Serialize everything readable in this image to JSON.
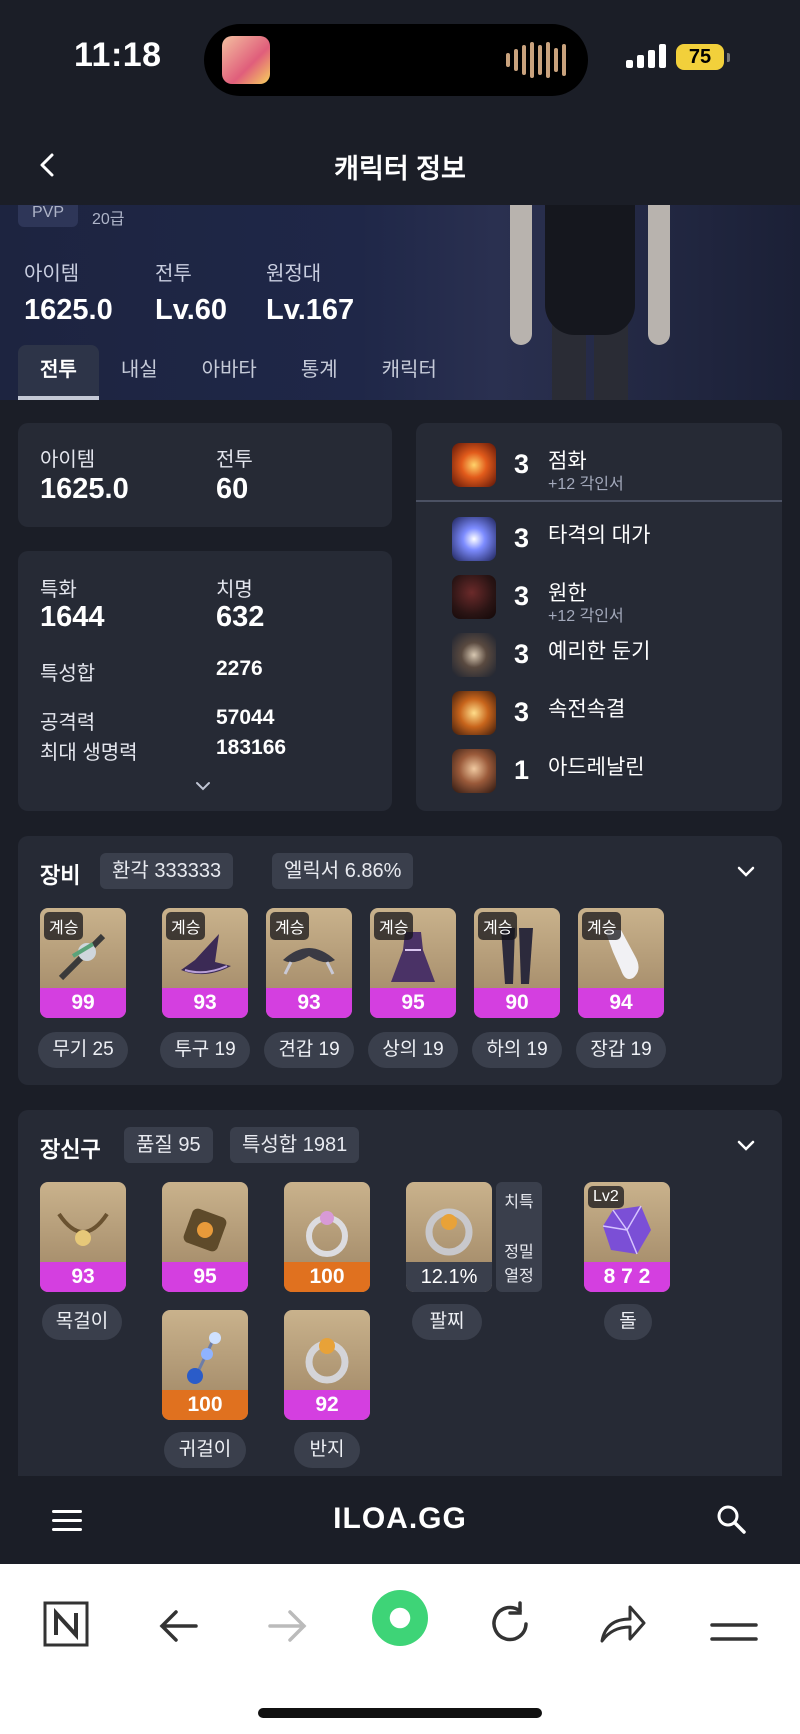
{
  "status": {
    "time": "11:18",
    "battery": "75"
  },
  "header": {
    "title": "캐릭터 정보"
  },
  "hero": {
    "pvp": "PVP",
    "grade": "20급",
    "stats": [
      {
        "label": "아이템",
        "value": "1625.0"
      },
      {
        "label": "전투",
        "value": "Lv.60"
      },
      {
        "label": "원정대",
        "value": "Lv.167"
      }
    ]
  },
  "tabs": [
    "전투",
    "내실",
    "아바타",
    "통계",
    "캐릭터"
  ],
  "summary": {
    "item_label": "아이템",
    "item_value": "1625.0",
    "combat_label": "전투",
    "combat_value": "60"
  },
  "stats": {
    "spec_label": "특화",
    "spec_value": "1644",
    "crit_label": "치명",
    "crit_value": "632",
    "sum_label": "특성합",
    "sum_value": "2276",
    "atk_label": "공격력",
    "atk_value": "57044",
    "hp_label": "최대 생명력",
    "hp_value": "183166"
  },
  "engravings": [
    {
      "level": "3",
      "name": "점화",
      "sub": "+12 각인서"
    },
    {
      "level": "3",
      "name": "타격의 대가",
      "sub": ""
    },
    {
      "level": "3",
      "name": "원한",
      "sub": "+12 각인서"
    },
    {
      "level": "3",
      "name": "예리한 둔기",
      "sub": ""
    },
    {
      "level": "3",
      "name": "속전속결",
      "sub": ""
    },
    {
      "level": "1",
      "name": "아드레날린",
      "sub": ""
    }
  ],
  "equipment": {
    "title": "장비",
    "transcend": "환각 333333",
    "elixir": "엘릭서 6.86%",
    "items": [
      {
        "tag": "계승",
        "quality": "99",
        "label": "무기 25"
      },
      {
        "tag": "계승",
        "quality": "93",
        "label": "투구 19"
      },
      {
        "tag": "계승",
        "quality": "93",
        "label": "견갑 19"
      },
      {
        "tag": "계승",
        "quality": "95",
        "label": "상의 19"
      },
      {
        "tag": "계승",
        "quality": "90",
        "label": "하의 19"
      },
      {
        "tag": "계승",
        "quality": "94",
        "label": "장갑 19"
      }
    ]
  },
  "accessories": {
    "title": "장신구",
    "quality": "품질 95",
    "stat_sum": "특성합 1981",
    "necklace": {
      "quality": "93",
      "label": "목걸이"
    },
    "earring1": {
      "quality": "95"
    },
    "ring1": {
      "quality": "100"
    },
    "bracelet": {
      "value": "12.1%",
      "label": "팔찌",
      "tag1": "치특",
      "tag2": "정밀",
      "tag3": "열정"
    },
    "stone": {
      "tag": "Lv2",
      "value": "8 7 2",
      "label": "돌"
    },
    "earring2": {
      "quality": "100",
      "label": "귀걸이"
    },
    "ring2": {
      "quality": "92",
      "label": "반지"
    }
  },
  "site": {
    "logo": "ILOA.GG"
  },
  "colors": {
    "quality_purple": "#d43fe0",
    "quality_orange": "#e0711f",
    "background": "#1b1e27",
    "card": "#262a35"
  }
}
